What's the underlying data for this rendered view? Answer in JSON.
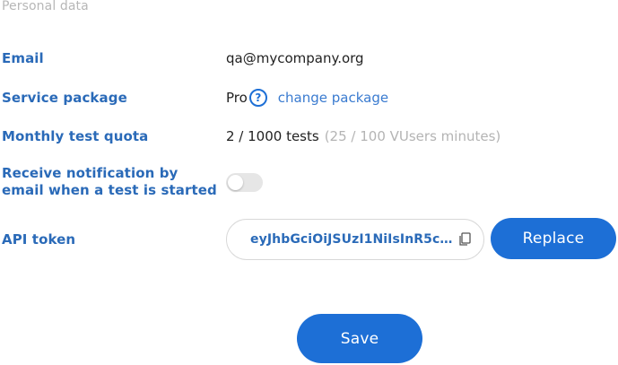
{
  "section_title": "Personal data",
  "fields": {
    "email": {
      "label": "Email",
      "value": "qa@mycompany.org"
    },
    "service_package": {
      "label": "Service package",
      "value": "Pro",
      "help_icon": "question-circle-icon",
      "link": "change package"
    },
    "quota": {
      "label": "Monthly test quota",
      "value": "2 / 1000 tests",
      "secondary": "(25 / 100 VUsers minutes)"
    },
    "notification": {
      "label_line1": "Receive notification by",
      "label_line2": "email when a test is started",
      "enabled": false
    },
    "api_token": {
      "label": "API token",
      "value": "eyJhbGciOiJSUzI1NiIsInR5cCI6I...",
      "copy_icon": "copy-icon"
    }
  },
  "buttons": {
    "replace": "Replace",
    "save": "Save"
  },
  "colors": {
    "accent": "#1d6fd6",
    "label": "#2a6ab8",
    "muted": "#b4b4b4"
  }
}
